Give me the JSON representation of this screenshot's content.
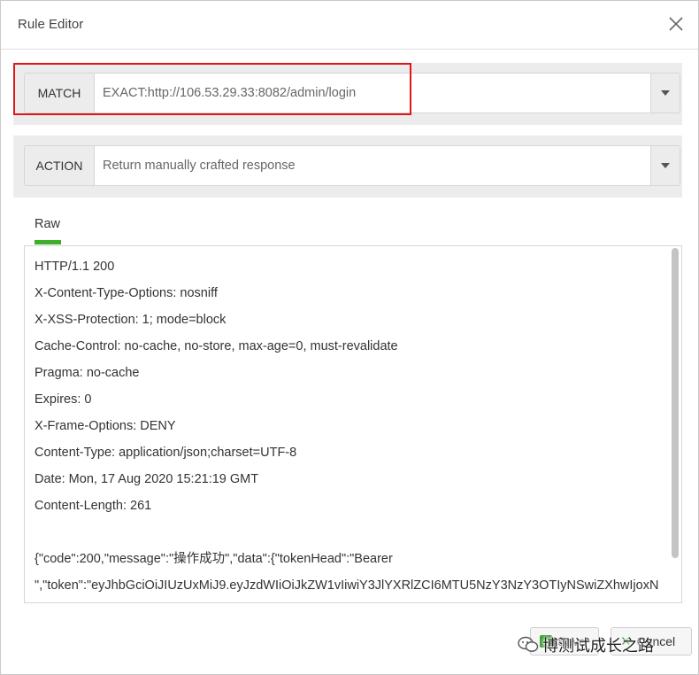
{
  "window": {
    "title": "Rule Editor"
  },
  "match": {
    "label": "MATCH",
    "value": "EXACT:http://106.53.29.33:8082/admin/login"
  },
  "action": {
    "label": "ACTION",
    "value": "Return manually crafted response"
  },
  "tabs": [
    {
      "label": "Raw",
      "active": true
    }
  ],
  "raw_lines": [
    "HTTP/1.1 200",
    "X-Content-Type-Options: nosniff",
    "X-XSS-Protection: 1; mode=block",
    "Cache-Control: no-cache, no-store, max-age=0, must-revalidate",
    "Pragma: no-cache",
    "Expires: 0",
    "X-Frame-Options: DENY",
    "Content-Type: application/json;charset=UTF-8",
    "Date: Mon, 17 Aug 2020 15:21:19 GMT",
    "Content-Length: 261",
    "",
    "{\"code\":200,\"message\":\"操作成功\",\"data\":{\"tokenHead\":\"Bearer",
    "\",\"token\":\"eyJhbGciOiJIUzUxMiJ9.eyJzdWIiOiJkZW1vIiwiY3JlYXRlZCI6MTU5NzY3NzY3OTIyNSwiZXhwIjoxN"
  ],
  "footer": {
    "save_label": "Save",
    "cancel_label": "Cancel"
  },
  "watermark": {
    "text": "博测试成长之路"
  },
  "colors": {
    "accent": "#3fae2a",
    "highlight": "#e0161b"
  }
}
